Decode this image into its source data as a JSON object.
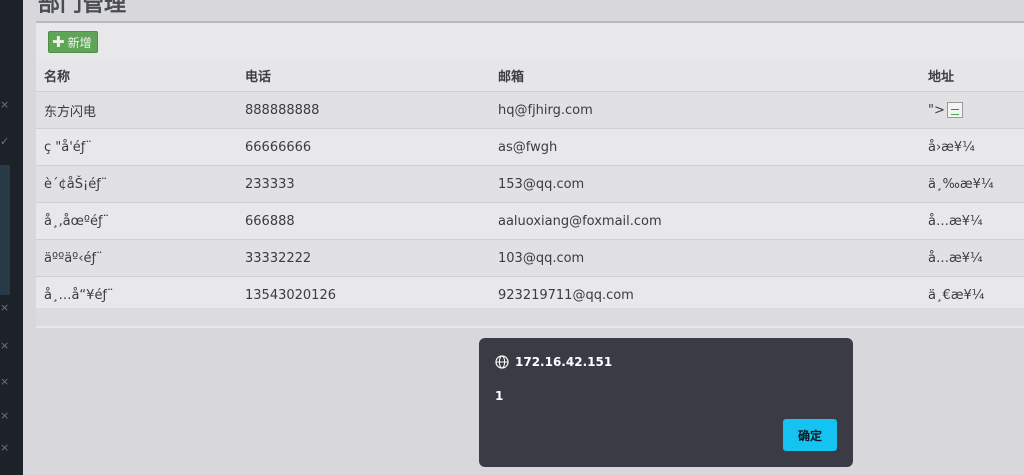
{
  "page": {
    "title": "部门管理"
  },
  "toolbar": {
    "add_label": "新增"
  },
  "table": {
    "headers": [
      "名称",
      "电话",
      "邮箱",
      "地址"
    ],
    "rows": [
      {
        "name": "东方闪电",
        "phone": "888888888",
        "email": "hq@fjhirg.com",
        "address": "\">"
      },
      {
        "name": "ç \"å'éƒ¨",
        "phone": "66666666",
        "email": "as@fwgh",
        "address": "å›æ¥¼"
      },
      {
        "name": "è´¢åŠ¡éƒ¨",
        "phone": "233333",
        "email": "153@qq.com",
        "address": "ä¸‰æ¥¼"
      },
      {
        "name": "å¸‚åœºéƒ¨",
        "phone": "666888",
        "email": "aaluoxiang@foxmail.com",
        "address": "å…æ¥¼"
      },
      {
        "name": "äººäº‹éƒ¨",
        "phone": "33332222",
        "email": "103@qq.com",
        "address": "å…æ¥¼"
      },
      {
        "name": "å¸…å“¥éƒ¨",
        "phone": "13543020126",
        "email": "923219711@qq.com",
        "address": "ä¸€æ¥¼"
      }
    ]
  },
  "dialog": {
    "origin": "172.16.42.151",
    "message": "1",
    "ok_label": "确定"
  }
}
